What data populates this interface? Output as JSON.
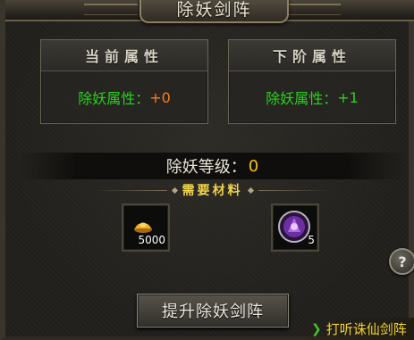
{
  "window": {
    "title": "除妖剑阵"
  },
  "current": {
    "header": "当前属性",
    "label": "除妖属性：",
    "value": "+0"
  },
  "next": {
    "header": "下阶属性",
    "label": "除妖属性：",
    "value": "+1"
  },
  "level": {
    "label": "除妖等级：",
    "value": "0"
  },
  "materials": {
    "title": "需要材料",
    "items": [
      {
        "icon": "gold-ingot-icon",
        "count": "5000"
      },
      {
        "icon": "purple-gem-icon",
        "count": "5"
      }
    ]
  },
  "buttons": {
    "upgrade": "提升除妖剑阵",
    "help": "?"
  },
  "link": {
    "text": "打听诛仙剑阵"
  },
  "colors": {
    "green": "#28d21e",
    "orange": "#ff7a1e",
    "gold": "#f0c318",
    "link": "#f2d12a"
  }
}
